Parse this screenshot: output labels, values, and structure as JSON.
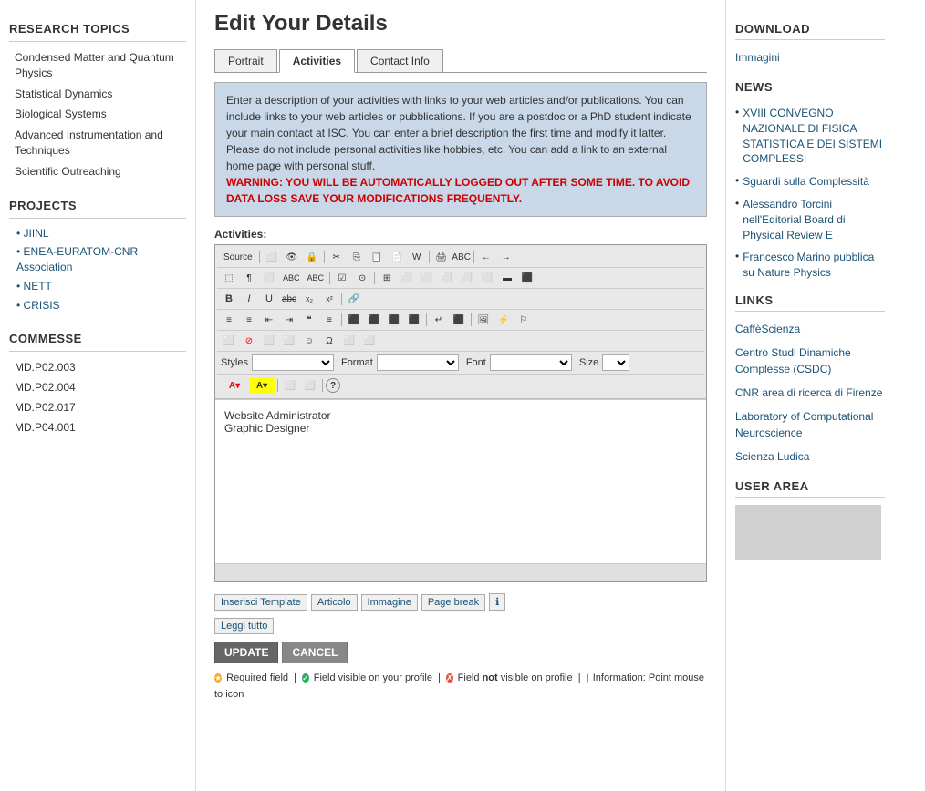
{
  "page": {
    "title": "Edit Your Details"
  },
  "sidebar": {
    "research_topics_title": "RESEARCH TOPICS",
    "topics": [
      {
        "label": "Condensed Matter and Quantum Physics"
      },
      {
        "label": "Statistical Dynamics"
      },
      {
        "label": "Biological Systems"
      },
      {
        "label": "Advanced Instrumentation and Techniques"
      },
      {
        "label": "Scientific Outreaching"
      }
    ],
    "projects_title": "PROJECTS",
    "projects": [
      {
        "label": "JIINL",
        "href": "#"
      },
      {
        "label": "ENEA-EURATOM-CNR Association",
        "href": "#"
      },
      {
        "label": "NETT",
        "href": "#"
      },
      {
        "label": "CRISIS",
        "href": "#"
      }
    ],
    "commesse_title": "COMMESSE",
    "commesse": [
      {
        "label": "MD.P02.003"
      },
      {
        "label": "MD.P02.004"
      },
      {
        "label": "MD.P02.017"
      },
      {
        "label": "MD.P04.001"
      }
    ]
  },
  "tabs": [
    {
      "label": "Portrait"
    },
    {
      "label": "Activities"
    },
    {
      "label": "Contact Info"
    }
  ],
  "active_tab": "Activities",
  "info_box": {
    "text": "Enter a description of your activities with links to your web articles and/or publications. You can include links to your web articles or pubblications. If you are a postdoc or a PhD student indicate your main contact at ISC. You can enter a brief description the first time and modify it latter.  Please do not include personal activities like hobbies, etc. You can add a link to an external home page with personal stuff.",
    "warning": "WARNING: YOU WILL BE AUTOMATICALLY LOGGED OUT AFTER SOME TIME. TO AVOID DATA LOSS SAVE YOUR MODIFICATIONS FREQUENTLY."
  },
  "activities_label": "Activities:",
  "editor": {
    "toolbar_rows": [
      [
        "Source",
        "⬜",
        "⬜",
        "🔒",
        "⬜",
        "⬜",
        "⬜",
        "⬜",
        "⬜",
        "⬜",
        "⬜",
        "⬜",
        "⬜",
        "←",
        "→"
      ],
      [
        "⬜",
        "⬜",
        "⬜",
        "ABC",
        "ABC",
        "⬜",
        "☑",
        "⊙",
        "⬜",
        "⬜",
        "⬜",
        "⬜",
        "⬜",
        "⬜",
        "⬜",
        "⬜"
      ],
      [
        "B",
        "I",
        "U",
        "abc",
        "x₂",
        "x²",
        "🔗"
      ],
      [
        "≡",
        "≡",
        "≡",
        "≡",
        "❝",
        "≡",
        "⬜",
        "⬜",
        "⬜",
        "⬜",
        "⬜",
        "⬜",
        "⬜",
        "⬜",
        "⬜"
      ],
      [
        "⬜",
        "🚫",
        "⬜",
        "⬜",
        "☺",
        "Ω",
        "⬜",
        "⬜"
      ]
    ],
    "styles_label": "Styles",
    "format_label": "Format",
    "font_label": "Font",
    "size_label": "Size",
    "content_lines": [
      "Website Administrator",
      "Graphic Designer"
    ]
  },
  "bottom_buttons": [
    {
      "label": "Inserisci Template"
    },
    {
      "label": "Articolo"
    },
    {
      "label": "Immagine"
    },
    {
      "label": "Page break"
    },
    {
      "label": "ℹ"
    },
    {
      "label": "Leggi tutto"
    }
  ],
  "action_buttons": {
    "update": "UPDATE",
    "cancel": "CANCEL"
  },
  "legend": {
    "required": "Required field",
    "visible": "Field visible on your profile",
    "not_visible": "Field not visible on profile",
    "info": "Information: Point mouse to icon"
  },
  "right_sidebar": {
    "download_title": "DOWNLOAD",
    "download_link": "Immagini",
    "news_title": "NEWS",
    "news_items": [
      {
        "label": "XVIII CONVEGNO NAZIONALE DI FISICA STATISTICA E DEI SISTEMI COMPLESSI"
      },
      {
        "label": "Sguardi sulla Complessità"
      },
      {
        "label": "Alessandro Torcini nell'Editorial Board di Physical Review E"
      },
      {
        "label": "Francesco Marino pubblica su Nature Physics"
      }
    ],
    "links_title": "LINKS",
    "links": [
      {
        "label": "CaffèScienza"
      },
      {
        "label": "Centro Studi Dinamiche Complesse (CSDC)"
      },
      {
        "label": "CNR area di ricerca di Firenze"
      },
      {
        "label": "Laboratory of Computational Neuroscience"
      },
      {
        "label": "Scienza Ludica"
      }
    ],
    "user_area_title": "USER AREA"
  }
}
